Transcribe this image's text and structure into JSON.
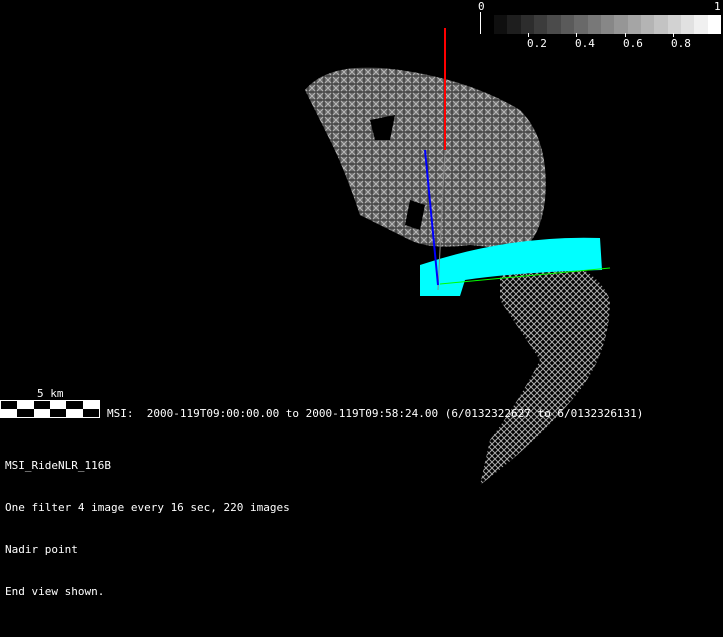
{
  "colorbar": {
    "min_label": "0",
    "max_label": "1",
    "tick_labels": [
      "0.2",
      "0.4",
      "0.6",
      "0.8"
    ],
    "steps": 17
  },
  "scale_bar": {
    "label": "5 km"
  },
  "info": {
    "time_range": "MSI:  2000-119T09:00:00.00 to 2000-119T09:58:24.00 (6/0132322627 to 6/0132326131)",
    "lines": [
      "MSI_RideNLR_116B",
      "One filter 4 image every 16 sec, 220 images",
      "Nadir point",
      "End view shown."
    ]
  },
  "colors": {
    "footprint": "#00ffff",
    "axis_x": "#ff0000",
    "axis_y": "#00ff00",
    "axis_z": "#0000ff"
  }
}
